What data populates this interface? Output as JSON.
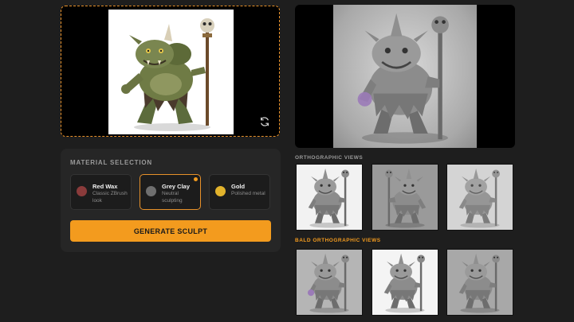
{
  "upload": {
    "preview_alt": "goblin-concept-art",
    "refresh_icon": "refresh-icon"
  },
  "material_selection": {
    "title": "MATERIAL SELECTION",
    "options": [
      {
        "name": "Red Wax",
        "desc": "Classic ZBrush look",
        "color": "#8a3b3b",
        "selected": false
      },
      {
        "name": "Grey Clay",
        "desc": "Neutral sculpting",
        "color": "#6f6f6f",
        "selected": true
      },
      {
        "name": "Gold",
        "desc": "Polished metal",
        "color": "#e2b32c",
        "selected": false
      }
    ],
    "generate_label": "GENERATE SCULPT"
  },
  "orthographic": {
    "title": "ORTHOGRAPHIC VIEWS"
  },
  "bald_orthographic": {
    "title": "BALD ORTHOGRAPHIC VIEWS"
  },
  "colors": {
    "accent": "#f39b1e",
    "background": "#1e1e1e",
    "panel": "#262626"
  }
}
